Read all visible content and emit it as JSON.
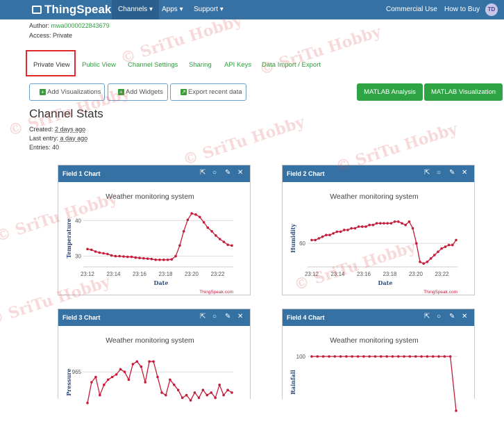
{
  "nav": {
    "logo": "ThingSpeak",
    "tm": "™",
    "channels": "Channels ▾",
    "apps": "Apps ▾",
    "support": "Support ▾",
    "commercial": "Commercial Use",
    "how_to_buy": "How to Buy",
    "avatar": "TD"
  },
  "meta": {
    "author_label": "Author:",
    "author": "mwa0000022843679",
    "access": "Access: Private"
  },
  "tabs": [
    "Private View",
    "Public View",
    "Channel Settings",
    "Sharing",
    "API Keys",
    "Data Import / Export"
  ],
  "buttons": {
    "add_viz": "Add Visualizations",
    "add_widgets": "Add Widgets",
    "export": "Export recent data",
    "matlab_analysis": "MATLAB Analysis",
    "matlab_viz": "MATLAB Visualization"
  },
  "stats": {
    "title": "Channel Stats",
    "created_label": "Created:",
    "created": "2 days ago",
    "last_label": "Last entry:",
    "last": "a day ago",
    "entries": "Entries: 40"
  },
  "watermark": "© SriTu Hobby",
  "charts": [
    {
      "header": "Field 1 Chart",
      "title": "Weather monitoring system",
      "ylabel": "Temperature",
      "xlabel": "Date",
      "credit": "ThingSpeak.com"
    },
    {
      "header": "Field 2 Chart",
      "title": "Weather monitoring system",
      "ylabel": "Humidity",
      "xlabel": "Date",
      "credit": "ThingSpeak.com"
    },
    {
      "header": "Field 3 Chart",
      "title": "Weather monitoring system",
      "ylabel": "Pressure",
      "xlabel": "",
      "credit": ""
    },
    {
      "header": "Field 4 Chart",
      "title": "Weather monitoring system",
      "ylabel": "Rainfall",
      "xlabel": "",
      "credit": ""
    }
  ],
  "chart_data": [
    {
      "type": "line",
      "title": "Weather monitoring system",
      "xlabel": "Date",
      "ylabel": "Temperature",
      "xticks": [
        "23:12",
        "23:14",
        "23:16",
        "23:18",
        "23:20",
        "23:22"
      ],
      "yticks": [
        30,
        40
      ],
      "ylim": [
        27,
        43
      ],
      "color": "#c41d3b",
      "series": [
        {
          "values": [
            32,
            31.8,
            31.3,
            31.0,
            30.8,
            30.6,
            30.2,
            30.0,
            30.0,
            29.9,
            29.8,
            29.8,
            29.6,
            29.5,
            29.4,
            29.3,
            29.2,
            29.0,
            29.0,
            29.0,
            29.0,
            29.1,
            30.0,
            33.0,
            37.0,
            40.2,
            42.0,
            41.7,
            41.0,
            39.5,
            38.0,
            37.0,
            35.8,
            34.8,
            34.0,
            33.2,
            33.0
          ]
        }
      ]
    },
    {
      "type": "line",
      "title": "Weather monitoring system",
      "xlabel": "Date",
      "ylabel": "Humidity",
      "xticks": [
        "23:12",
        "23:14",
        "23:16",
        "23:18",
        "23:20",
        "23:22"
      ],
      "yticks": [
        60
      ],
      "ylim": [
        46,
        80
      ],
      "color": "#c41d3b",
      "series": [
        {
          "values": [
            62,
            62,
            63,
            64,
            65,
            65,
            66,
            67,
            67,
            68,
            68,
            69,
            69,
            70,
            70,
            70,
            71,
            71,
            72,
            72,
            72,
            72,
            72,
            73,
            73,
            72,
            71,
            73,
            69,
            60,
            49,
            48,
            49,
            51,
            53,
            55,
            57,
            58,
            59,
            59,
            62
          ]
        }
      ]
    },
    {
      "type": "line",
      "title": "Weather monitoring system",
      "xlabel": "",
      "ylabel": "Pressure",
      "xticks": [],
      "yticks": [
        965
      ],
      "ylim": [
        950,
        972
      ],
      "color": "#c41d3b",
      "series": [
        {
          "values": [
            953,
            961,
            963,
            956,
            960,
            962,
            963,
            964,
            966,
            965,
            962,
            968,
            969,
            967,
            961,
            969,
            969,
            963,
            957,
            956,
            962,
            960,
            958,
            955,
            956,
            954,
            957,
            955,
            958,
            956,
            957,
            955,
            960,
            956,
            958,
            957
          ]
        }
      ]
    },
    {
      "type": "line",
      "title": "Weather monitoring system",
      "xlabel": "",
      "ylabel": "Rainfall",
      "xticks": [],
      "yticks": [
        100
      ],
      "ylim": [
        0,
        105
      ],
      "color": "#c41d3b",
      "series": [
        {
          "values": [
            100,
            100,
            100,
            100,
            100,
            100,
            100,
            100,
            100,
            100,
            100,
            100,
            100,
            100,
            100,
            100,
            100,
            100,
            100,
            100,
            100,
            100,
            100,
            100,
            100,
            0
          ]
        }
      ]
    }
  ]
}
